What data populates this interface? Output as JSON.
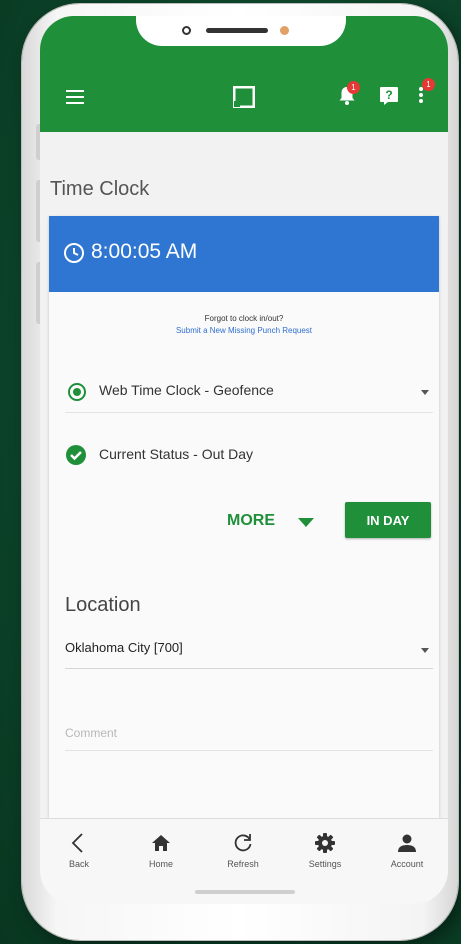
{
  "app": {
    "notifications_badge": "1",
    "more_badge": "1",
    "brand_color": "#1f8f3a",
    "accent_color": "#2f76d2"
  },
  "page": {
    "title": "Time Clock"
  },
  "clock": {
    "time": "8:00:05 AM",
    "icon": "clock-icon"
  },
  "missing_punch": {
    "prompt": "Forgot to clock in/out?",
    "link": "Submit a New Missing Punch Request"
  },
  "time_clock_select": {
    "value": "Web Time Clock - Geofence",
    "icon": "radio-target-icon"
  },
  "status": {
    "text": "Current Status - Out Day",
    "icon": "check-circle-icon"
  },
  "actions": {
    "more_label": "MORE",
    "in_day_label": "IN DAY"
  },
  "location": {
    "label": "Location",
    "value": "Oklahoma City [700]"
  },
  "comment": {
    "placeholder": "Comment"
  },
  "bottom_nav": {
    "items": [
      {
        "label": "Back",
        "icon": "chevron-left-icon"
      },
      {
        "label": "Home",
        "icon": "home-icon"
      },
      {
        "label": "Refresh",
        "icon": "refresh-icon"
      },
      {
        "label": "Settings",
        "icon": "gear-icon"
      },
      {
        "label": "Account",
        "icon": "person-icon"
      }
    ]
  }
}
